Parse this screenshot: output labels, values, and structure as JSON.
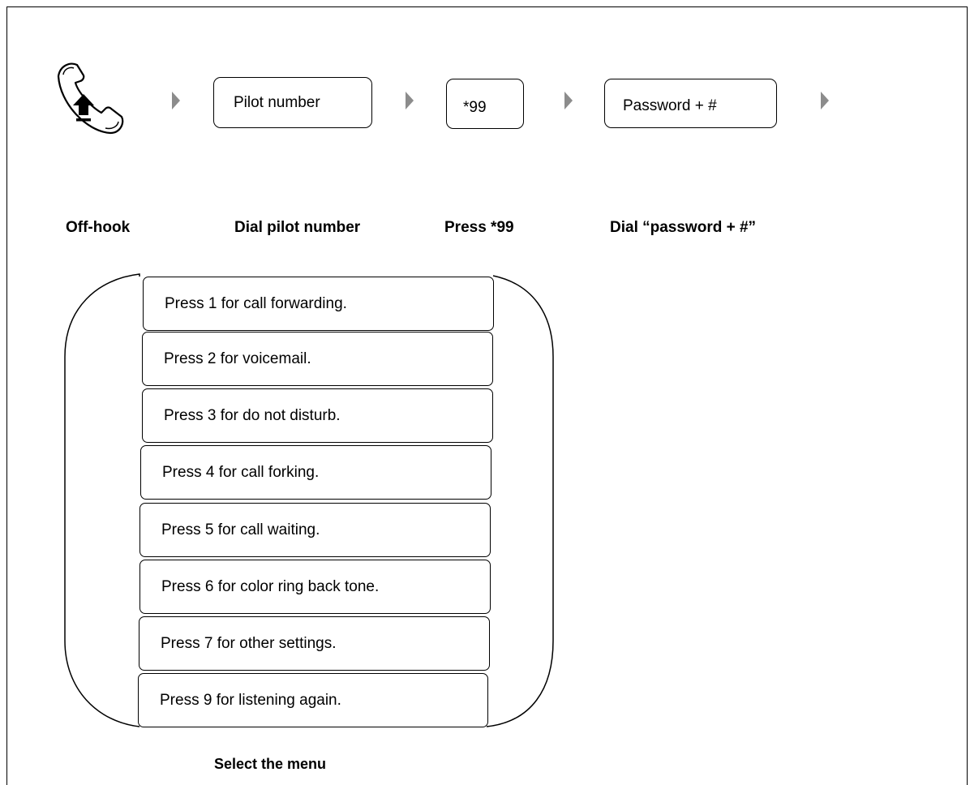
{
  "steps": {
    "pilot_box": "Pilot number",
    "code_box": "*99",
    "password_box": "Password + #"
  },
  "labels": {
    "offhook": "Off-hook",
    "dial_pilot": "Dial pilot number",
    "press_code": "Press *99",
    "dial_password": "Dial “password + #”",
    "select_menu": "Select the menu"
  },
  "menu": {
    "items": [
      "Press 1 for call forwarding.",
      "Press 2 for voicemail.",
      "Press 3 for do not disturb.",
      "Press 4 for call forking.",
      "Press 5 for call waiting.",
      "Press 6 for color ring back tone.",
      "Press 7 for other settings.",
      "Press 9 for listening again."
    ]
  },
  "colors": {
    "arrow": "#8c8c8c",
    "stroke": "#000000"
  }
}
